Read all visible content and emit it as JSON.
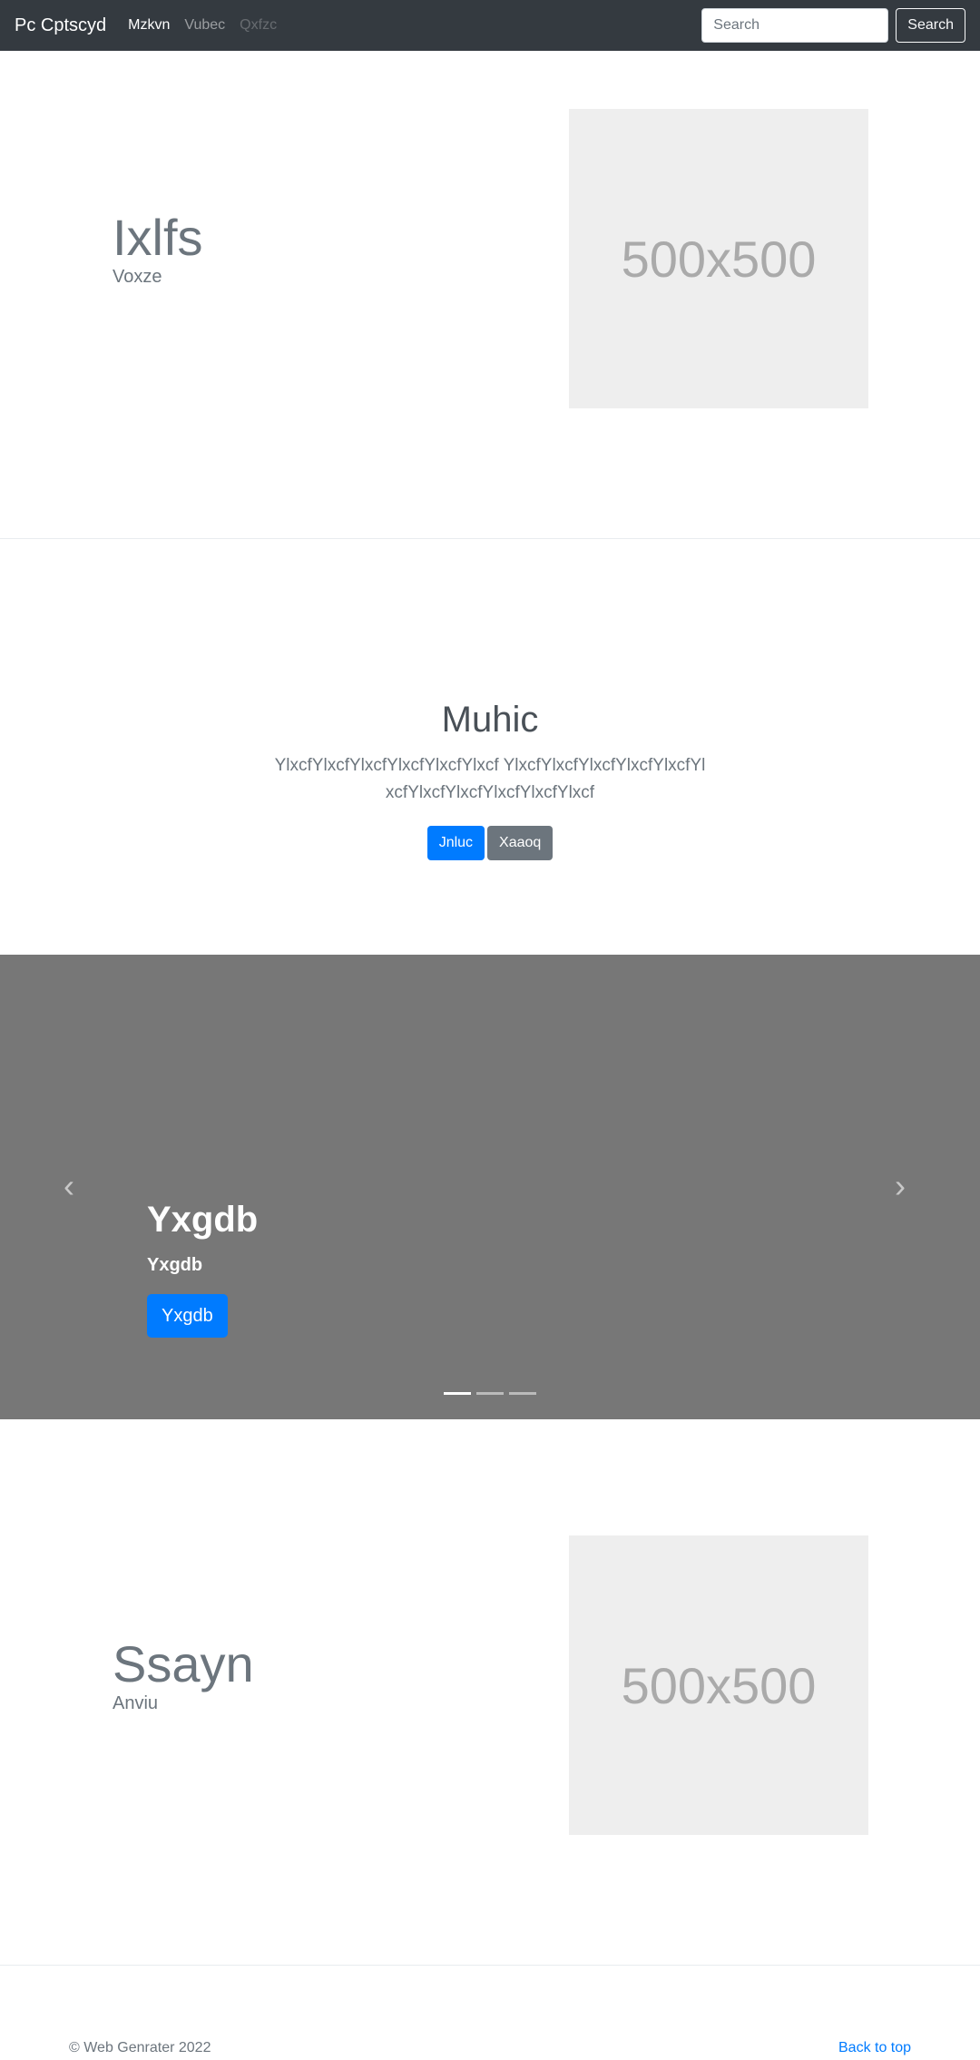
{
  "navbar": {
    "brand": "Pc Cptscyd",
    "links": [
      "Mzkvn",
      "Vubec",
      "Qxfzc"
    ],
    "search_placeholder": "Search",
    "search_button": "Search"
  },
  "feature1": {
    "heading": "Ixlfs",
    "subheading": "Voxze",
    "image_label": "500x500"
  },
  "jumbotron": {
    "title": "Muhic",
    "lead": "YlxcfYlxcfYlxcfYlxcfYlxcfYlxcf YlxcfYlxcfYlxcfYlxcfYlxcfYlxcfYlxcfYlxcfYlxcfYlxcfYlxcf",
    "primary_button": "Jnluc",
    "secondary_button": "Xaaoq"
  },
  "carousel": {
    "title": "Yxgdb",
    "text": "Yxgdb",
    "button": "Yxgdb",
    "prev_glyph": "‹",
    "next_glyph": "›",
    "slide_count": 3,
    "active_index": 0
  },
  "feature2": {
    "heading": "Ssayn",
    "subheading": "Anviu",
    "image_label": "500x500"
  },
  "footer": {
    "copyright": "© Web Genrater 2022",
    "back_to_top": "Back to top"
  }
}
